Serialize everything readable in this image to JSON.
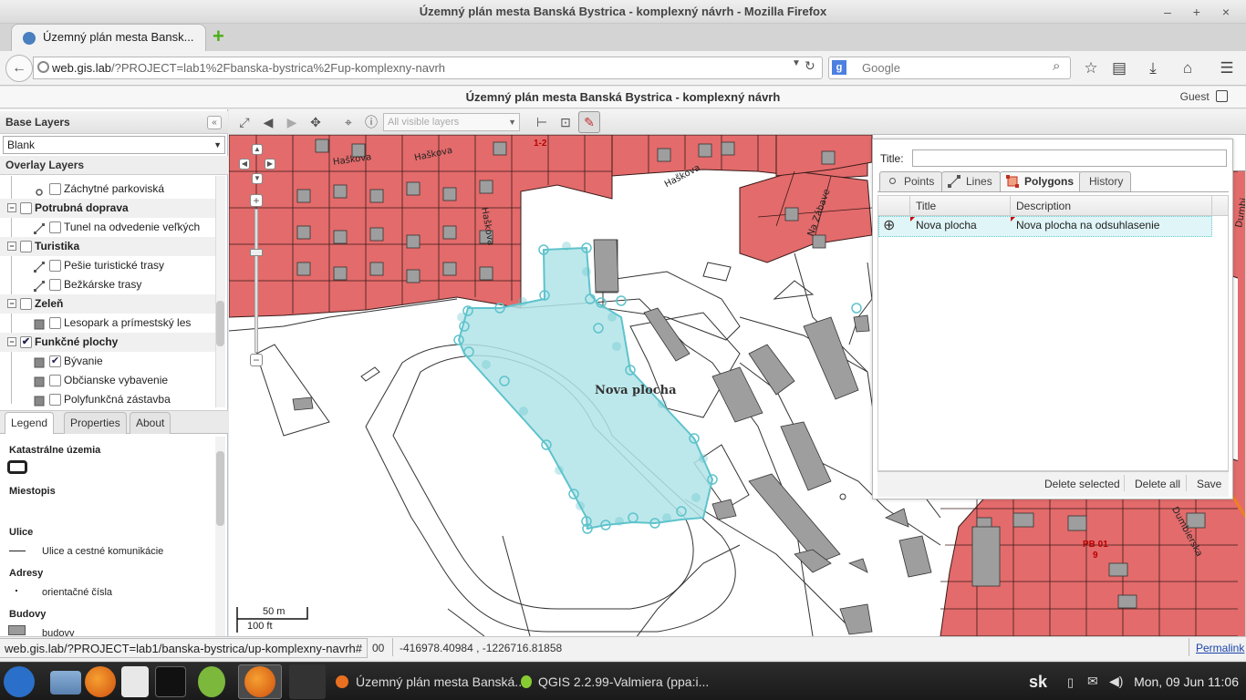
{
  "window": {
    "title": "Územný plán mesta Banská Bystrica - komplexný návrh - Mozilla Firefox",
    "controls": "– + ×"
  },
  "browser": {
    "tab_title": "Územný plán mesta Bansk...",
    "url_host": "web.gis.lab",
    "url_path": "/?PROJECT=lab1%2Fbanska-bystrica%2Fup-komplexny-navrh",
    "search_placeholder": "Google",
    "search_engine_letter": "g"
  },
  "app": {
    "title": "Územný plán mesta Banská Bystrica - komplexný návrh",
    "user": "Guest"
  },
  "left_panel": {
    "base_layers_title": "Base Layers",
    "base_layer_selected": "Blank",
    "overlay_layers_title": "Overlay Layers",
    "tree": [
      {
        "label": "Záchytné parkoviská",
        "type": "child",
        "checked": false
      },
      {
        "label": "Potrubná doprava",
        "type": "group",
        "checked": false
      },
      {
        "label": "Tunel na odvedenie veľkých vod",
        "type": "child",
        "checked": false
      },
      {
        "label": "Turistika",
        "type": "group",
        "checked": false
      },
      {
        "label": "Pešie turistické trasy",
        "type": "child",
        "checked": false
      },
      {
        "label": "Bežkárske trasy",
        "type": "child",
        "checked": false
      },
      {
        "label": "Zeleň",
        "type": "group",
        "checked": false
      },
      {
        "label": "Lesopark a prímestský les",
        "type": "child",
        "checked": false
      },
      {
        "label": "Funkčné plochy",
        "type": "group",
        "checked": true
      },
      {
        "label": "Bývanie",
        "type": "child",
        "checked": true
      },
      {
        "label": "Občianske vybavenie",
        "type": "child",
        "checked": false
      },
      {
        "label": "Polyfunkčná zástavba",
        "type": "child",
        "checked": false
      }
    ],
    "tabs": [
      "Legend",
      "Properties",
      "About"
    ],
    "legend": [
      {
        "text": "Katastrálne územia",
        "bold": true
      },
      {
        "text": "Miestopis",
        "bold": true
      },
      {
        "text": "Ulice",
        "bold": true
      },
      {
        "text": "Ulice a cestné komunikácie",
        "bold": false
      },
      {
        "text": "Adresy",
        "bold": true
      },
      {
        "text": "orientačné čísla",
        "bold": false
      },
      {
        "text": "Budovy",
        "bold": true
      },
      {
        "text": "budovy",
        "bold": false
      }
    ]
  },
  "toolbar": {
    "layer_select": "All visible layers"
  },
  "map": {
    "streets": [
      "Haškova",
      "Haškova",
      "Haškova",
      "Haškova",
      "Na Zábave",
      "Dumbierska",
      "Dumbi"
    ],
    "parcel_labels": [
      "PB 01",
      "9",
      "1-2",
      "PB 01"
    ],
    "feature_label": "Nova plocha",
    "scale_metric": "50 m",
    "scale_imperial": "100 ft",
    "colors": {
      "parcel_fill": "#e36b6b",
      "polygon_fill": "#b2e4e8",
      "polygon_stroke": "#5ec3cc",
      "building": "#9e9e9e"
    }
  },
  "digitize": {
    "title_label": "Title:",
    "title_value": "",
    "tabs": [
      "Points",
      "Lines",
      "Polygons",
      "History"
    ],
    "active_tab": "Polygons",
    "columns": [
      "Title",
      "Description"
    ],
    "rows": [
      {
        "title": "Nova plocha",
        "description": "Nova plocha na odsuhlasenie"
      }
    ],
    "buttons": [
      "Delete selected",
      "Delete all",
      "Save"
    ]
  },
  "status": {
    "link_url": "web.gis.lab/?PROJECT=lab1/banska-bystrica/up-komplexny-navrh#",
    "scale_tail": "00",
    "coordinates": "-416978.40984 , -1226716.81858",
    "permalink": "Permalink"
  },
  "taskbar": {
    "tasks": [
      "Územný plán mesta Banská...",
      "QGIS 2.2.99-Valmiera (ppa:i..."
    ],
    "keyboard": "sk",
    "clock": "Mon, 09 Jun  11:06"
  }
}
